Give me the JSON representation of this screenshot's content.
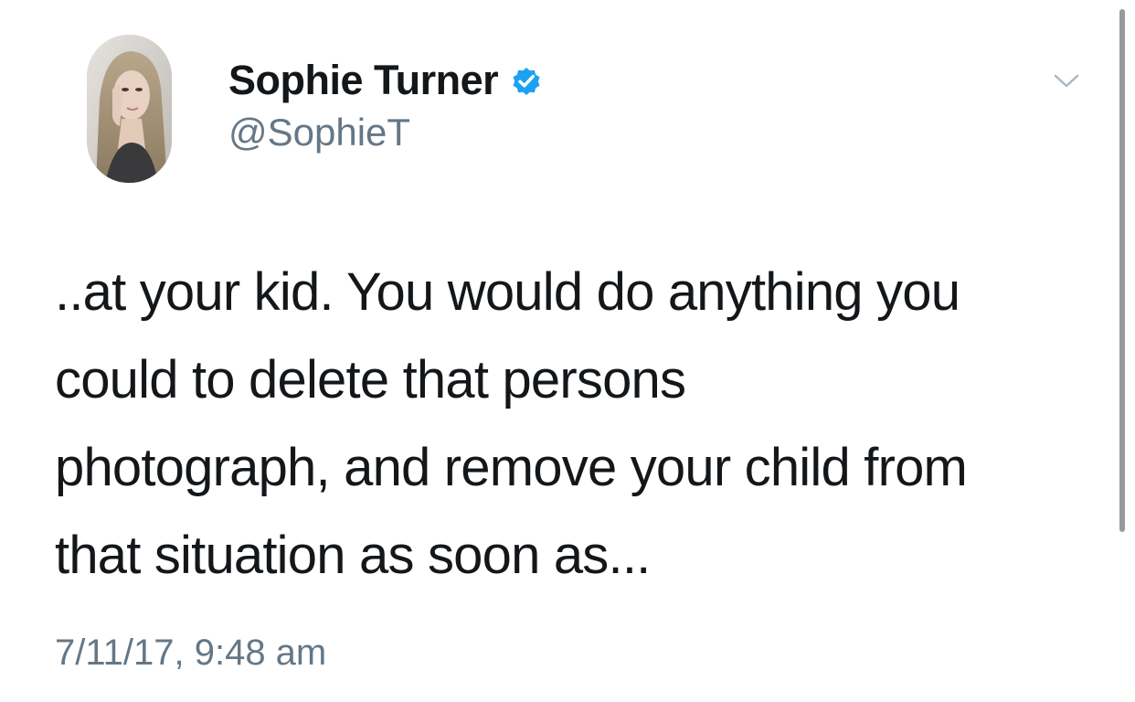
{
  "user": {
    "display_name": "Sophie Turner",
    "handle": "@SophieT",
    "verified": true,
    "verified_icon": "verified-badge-icon",
    "verified_color": "#1da1f2"
  },
  "tweet": {
    "lines": [
      "..at your kid. You would do anything you",
      "could to delete that persons",
      "photograph, and remove your child from",
      "that situation as soon as..."
    ],
    "timestamp": "7/11/17, 9:48 am"
  },
  "menu": {
    "icon": "chevron-down-icon"
  },
  "colors": {
    "text_primary": "#14171a",
    "text_secondary": "#657786",
    "accent": "#1da1f2",
    "background": "#ffffff"
  }
}
